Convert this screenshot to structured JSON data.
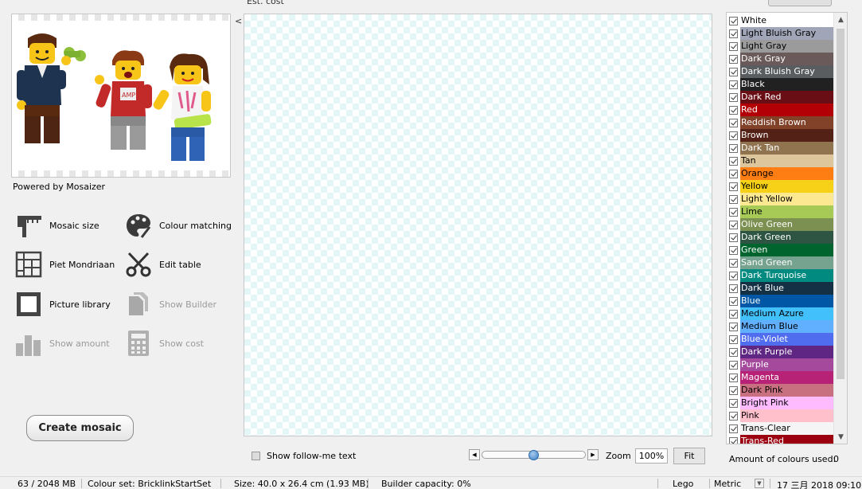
{
  "header": {
    "est_cost_label": "Est. cost"
  },
  "preview": {
    "powered_by": "Powered by Mosaizer",
    "collapse_arrow": "<"
  },
  "tools": [
    {
      "label": "Mosaic size",
      "icon": "ruler-icon",
      "enabled": true
    },
    {
      "label": "Colour matching",
      "icon": "palette-icon",
      "enabled": true
    },
    {
      "label": "Piet Mondriaan",
      "icon": "grid-icon",
      "enabled": true
    },
    {
      "label": "Edit table",
      "icon": "scissors-icon",
      "enabled": true
    },
    {
      "label": "Picture library",
      "icon": "picture-frame-icon",
      "enabled": true
    },
    {
      "label": "Show Builder",
      "icon": "documents-icon",
      "enabled": false
    },
    {
      "label": "Show amount",
      "icon": "bar-chart-icon",
      "enabled": false
    },
    {
      "label": "Show cost",
      "icon": "calculator-icon",
      "enabled": false
    }
  ],
  "create_label": "Create mosaic",
  "bottom": {
    "follow_text": "Show follow-me text",
    "zoom_label": "Zoom",
    "zoom_value": "100%",
    "fit_label": "Fit",
    "zoom_slider_value": 0.5
  },
  "colours": [
    {
      "name": "White",
      "bg": "#ffffff",
      "fg": "#000000",
      "checked": true
    },
    {
      "name": "Light Bluish Gray",
      "bg": "#a0a5b8",
      "fg": "#000000",
      "checked": true
    },
    {
      "name": "Light Gray",
      "bg": "#9b9b9b",
      "fg": "#000000",
      "checked": true
    },
    {
      "name": "Dark Gray",
      "bg": "#6b5a5a",
      "fg": "#ffffff",
      "checked": true
    },
    {
      "name": "Dark Bluish Gray",
      "bg": "#595d60",
      "fg": "#ffffff",
      "checked": true
    },
    {
      "name": "Black",
      "bg": "#212121",
      "fg": "#ffffff",
      "checked": true
    },
    {
      "name": "Dark Red",
      "bg": "#6a0e15",
      "fg": "#ffffff",
      "checked": true
    },
    {
      "name": "Red",
      "bg": "#b30006",
      "fg": "#ffffff",
      "checked": true
    },
    {
      "name": "Reddish Brown",
      "bg": "#82422a",
      "fg": "#ffffff",
      "checked": true
    },
    {
      "name": "Brown",
      "bg": "#532115",
      "fg": "#ffffff",
      "checked": true
    },
    {
      "name": "Dark Tan",
      "bg": "#907450",
      "fg": "#ffffff",
      "checked": true
    },
    {
      "name": "Tan",
      "bg": "#dec69c",
      "fg": "#000000",
      "checked": true
    },
    {
      "name": "Orange",
      "bg": "#ff7e14",
      "fg": "#000000",
      "checked": true
    },
    {
      "name": "Yellow",
      "bg": "#f7d117",
      "fg": "#000000",
      "checked": true
    },
    {
      "name": "Light Yellow",
      "bg": "#fbe890",
      "fg": "#000000",
      "checked": true
    },
    {
      "name": "Lime",
      "bg": "#a6ca55",
      "fg": "#000000",
      "checked": true
    },
    {
      "name": "Olive Green",
      "bg": "#7c9051",
      "fg": "#ffffff",
      "checked": true
    },
    {
      "name": "Dark Green",
      "bg": "#2e5543",
      "fg": "#ffffff",
      "checked": true
    },
    {
      "name": "Green",
      "bg": "#00642e",
      "fg": "#ffffff",
      "checked": true
    },
    {
      "name": "Sand Green",
      "bg": "#76a290",
      "fg": "#ffffff",
      "checked": true
    },
    {
      "name": "Dark Turquoise",
      "bg": "#008a80",
      "fg": "#ffffff",
      "checked": true
    },
    {
      "name": "Dark Blue",
      "bg": "#143044",
      "fg": "#ffffff",
      "checked": true
    },
    {
      "name": "Blue",
      "bg": "#0057a6",
      "fg": "#ffffff",
      "checked": true
    },
    {
      "name": "Medium Azure",
      "bg": "#42c0fb",
      "fg": "#000000",
      "checked": true
    },
    {
      "name": "Medium Blue",
      "bg": "#61afff",
      "fg": "#000000",
      "checked": true
    },
    {
      "name": "Blue-Violet",
      "bg": "#506cef",
      "fg": "#ffffff",
      "checked": true
    },
    {
      "name": "Dark Purple",
      "bg": "#5f2683",
      "fg": "#ffffff",
      "checked": true
    },
    {
      "name": "Purple",
      "bg": "#a5499c",
      "fg": "#ffffff",
      "checked": true
    },
    {
      "name": "Magenta",
      "bg": "#b72276",
      "fg": "#ffffff",
      "checked": true
    },
    {
      "name": "Dark Pink",
      "bg": "#c87080",
      "fg": "#000000",
      "checked": true
    },
    {
      "name": "Bright Pink",
      "bg": "#ffbbff",
      "fg": "#000000",
      "checked": true
    },
    {
      "name": "Pink",
      "bg": "#ffc0cb",
      "fg": "#000000",
      "checked": true
    },
    {
      "name": "Trans-Clear",
      "bg": "#f5f5f5",
      "fg": "#000000",
      "checked": true
    },
    {
      "name": "Trans-Red",
      "bg": "#9c0010",
      "fg": "#ffffff",
      "checked": true
    }
  ],
  "amount": {
    "label": "Amount of colours used:",
    "value": "0"
  },
  "status": {
    "memory": "63 / 2048 MB",
    "colour_set": "Colour set: BricklinkStartSet",
    "size": "Size: 40.0 x 26.4 cm (1.93 MB)",
    "capacity": "Builder capacity: 0%",
    "brand": "Lego",
    "units": "Metric",
    "datetime": "17 三月 2018  09:10"
  }
}
